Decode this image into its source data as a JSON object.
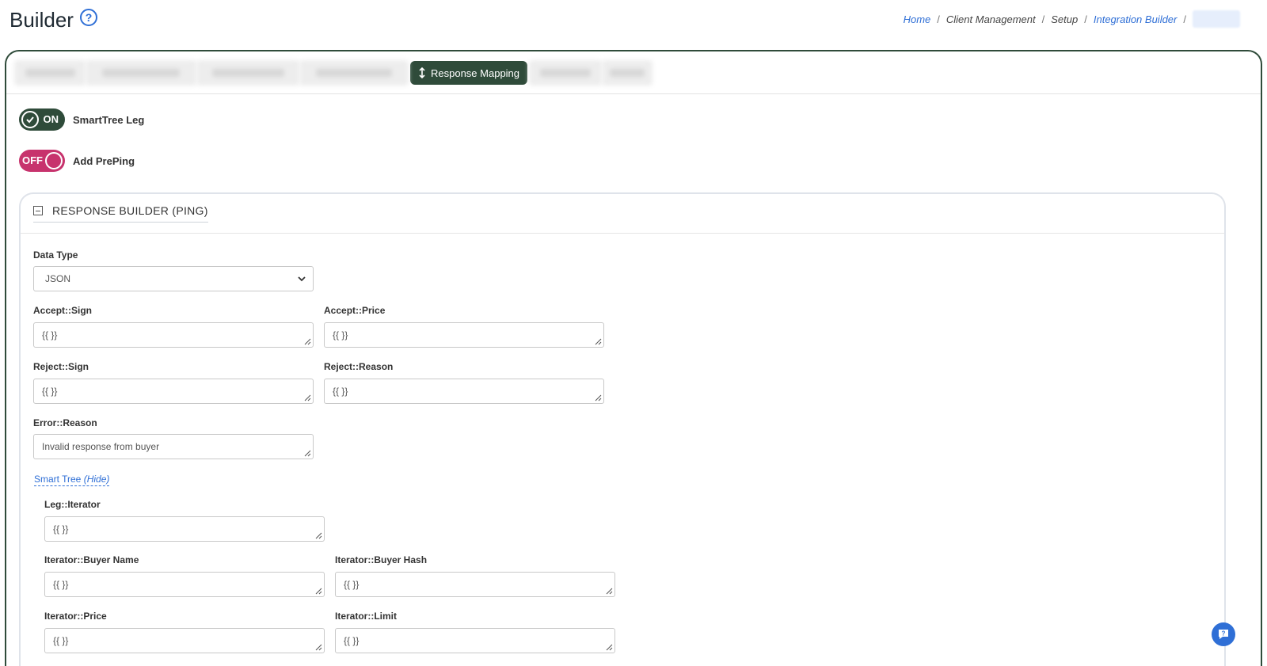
{
  "header": {
    "title": "Builder",
    "help_icon": "question-circle-icon",
    "breadcrumb": {
      "home": "Home",
      "client_management": "Client Management",
      "setup": "Setup",
      "integration_builder": "Integration Builder",
      "separator": "/"
    }
  },
  "tabs": {
    "active_label": "Response Mapping",
    "active_icon": "up-down-arrow-icon"
  },
  "toggles": {
    "smarttree": {
      "state": "ON",
      "label": "SmartTree Leg"
    },
    "preping": {
      "state": "OFF",
      "label": "Add PrePing"
    }
  },
  "response_builder": {
    "title": "RESPONSE BUILDER (PING)",
    "data_type": {
      "label": "Data Type",
      "value": "JSON"
    },
    "accept_sign": {
      "label": "Accept::Sign",
      "value": "{{ }}"
    },
    "accept_price": {
      "label": "Accept::Price",
      "value": "{{ }}"
    },
    "reject_sign": {
      "label": "Reject::Sign",
      "value": "{{ }}"
    },
    "reject_reason": {
      "label": "Reject::Reason",
      "value": "{{ }}"
    },
    "error_reason": {
      "label": "Error::Reason",
      "value": "Invalid response from buyer"
    },
    "smart_tree_link": {
      "text": "Smart Tree",
      "toggle": "(Hide)"
    },
    "leg_iterator": {
      "label": "Leg::Iterator",
      "value": "{{ }}"
    },
    "iterator_buyer_name": {
      "label": "Iterator::Buyer Name",
      "value": "{{ }}"
    },
    "iterator_buyer_hash": {
      "label": "Iterator::Buyer Hash",
      "value": "{{ }}"
    },
    "iterator_price": {
      "label": "Iterator::Price",
      "value": "{{ }}"
    },
    "iterator_limit": {
      "label": "Iterator::Limit",
      "value": "{{ }}"
    }
  },
  "colors": {
    "accent_green": "#2f4b3a",
    "toggle_off": "#c7336d",
    "link_blue": "#2f6fd6"
  }
}
